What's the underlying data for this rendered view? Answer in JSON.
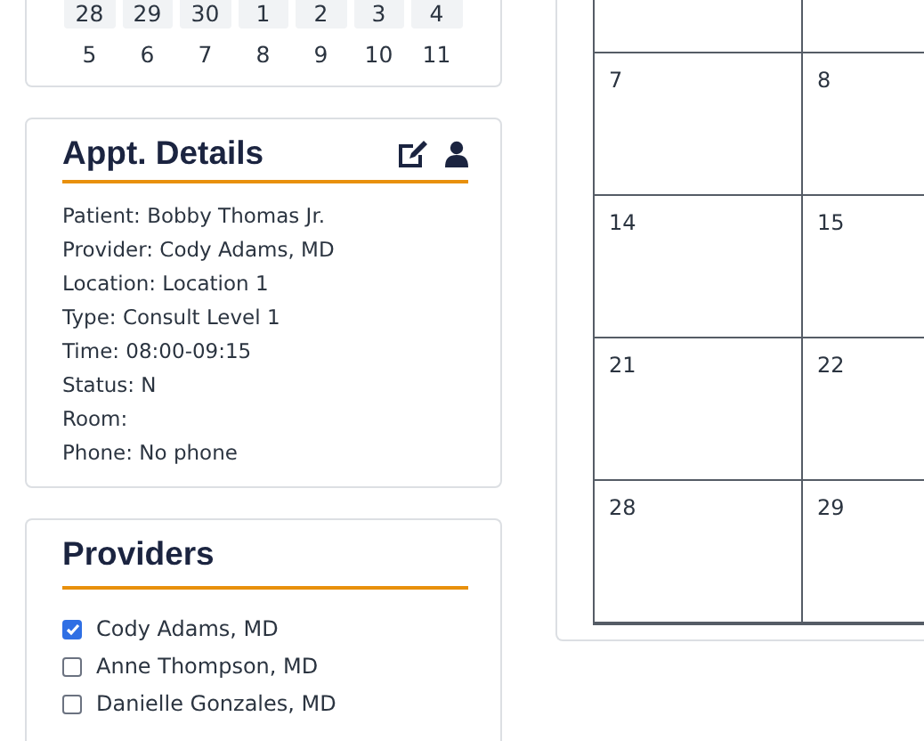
{
  "mini_calendar": {
    "weeks": [
      {
        "days": [
          "28",
          "29",
          "30",
          "1",
          "2",
          "3",
          "4"
        ],
        "highlighted": true
      },
      {
        "days": [
          "5",
          "6",
          "7",
          "8",
          "9",
          "10",
          "11"
        ],
        "highlighted": false
      }
    ]
  },
  "appt_details": {
    "title": "Appt. Details",
    "lines": [
      "Patient: Bobby Thomas Jr.",
      "Provider: Cody Adams, MD",
      "Location: Location 1",
      "Type: Consult Level 1",
      "Time: 08:00-09:15",
      "Status: N",
      "Room:",
      "Phone: No phone"
    ]
  },
  "providers": {
    "title": "Providers",
    "items": [
      {
        "name": "Cody Adams, MD",
        "checked": true
      },
      {
        "name": "Anne Thompson, MD",
        "checked": false
      },
      {
        "name": "Danielle Gonzales, MD",
        "checked": false
      }
    ]
  },
  "month_grid": {
    "weeks": [
      [
        "7",
        "8"
      ],
      [
        "14",
        "15"
      ],
      [
        "21",
        "22"
      ],
      [
        "28",
        "29"
      ]
    ]
  }
}
